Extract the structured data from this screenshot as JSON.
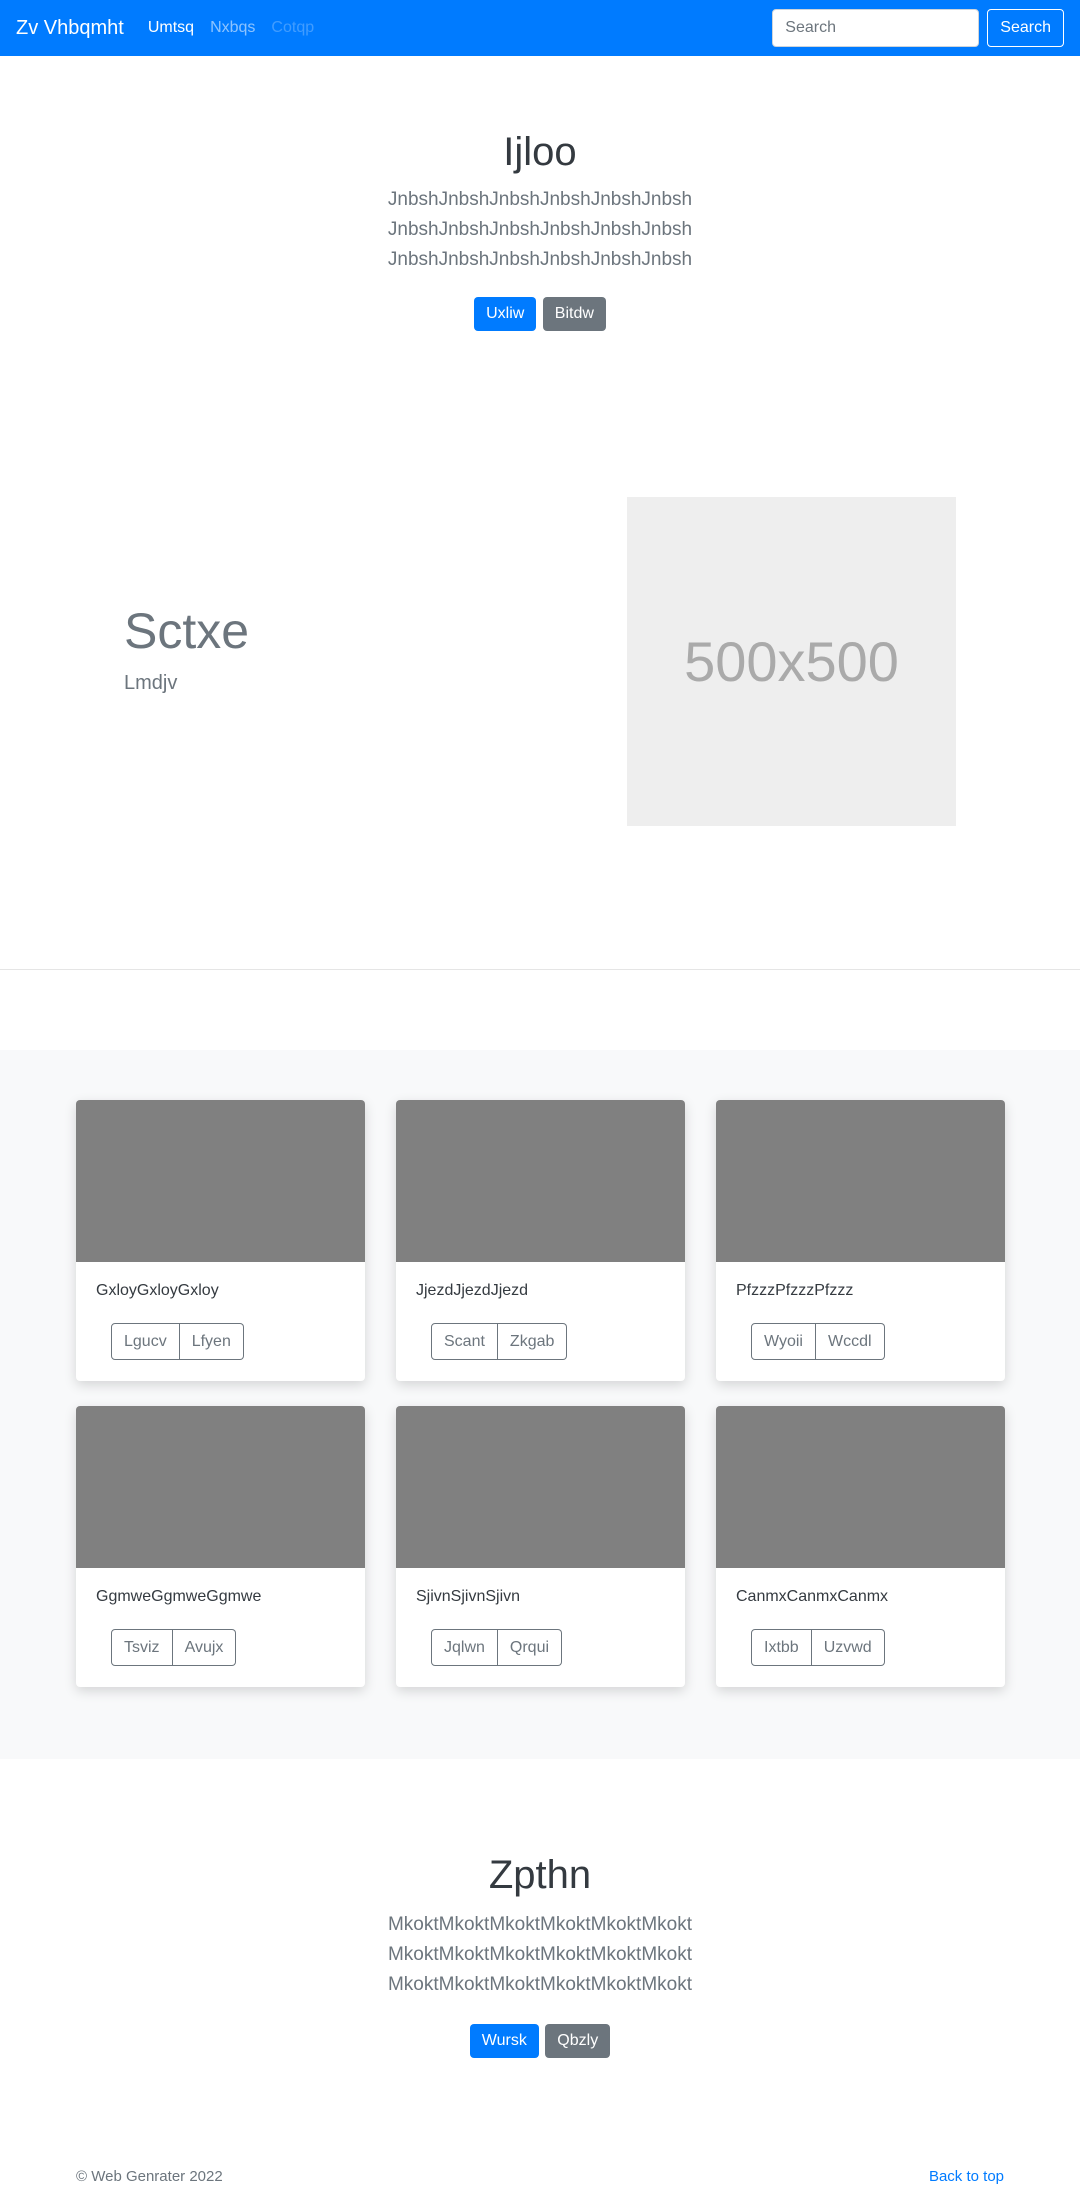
{
  "navbar": {
    "brand": "Zv Vhbqmht",
    "links": [
      {
        "label": "Umtsq"
      },
      {
        "label": "Nxbqs"
      },
      {
        "label": "Cotqp"
      }
    ],
    "search_placeholder": "Search",
    "search_button": "Search"
  },
  "hero": {
    "title": "Ijloo",
    "text": "JnbshJnbshJnbshJnbshJnbshJnbsh JnbshJnbshJnbshJnbshJnbshJnbsh JnbshJnbshJnbshJnbshJnbshJnbsh",
    "primary_button": "Uxliw",
    "secondary_button": "Bitdw"
  },
  "feature": {
    "title": "Sctxe",
    "subtitle": "Lmdjv",
    "placeholder_label": "500x500"
  },
  "cards": [
    {
      "text": "GxloyGxloyGxloy",
      "btn1": "Lgucv",
      "btn2": "Lfyen"
    },
    {
      "text": "JjezdJjezdJjezd",
      "btn1": "Scant",
      "btn2": "Zkgab"
    },
    {
      "text": "PfzzzPfzzzPfzzz",
      "btn1": "Wyoii",
      "btn2": "Wccdl"
    },
    {
      "text": "GgmweGgmweGgmwe",
      "btn1": "Tsviz",
      "btn2": "Avujx"
    },
    {
      "text": "SjivnSjivnSjivn",
      "btn1": "Jqlwn",
      "btn2": "Qrqui"
    },
    {
      "text": "CanmxCanmxCanmx",
      "btn1": "Ixtbb",
      "btn2": "Uzvwd"
    }
  ],
  "bottom_hero": {
    "title": "Zpthn",
    "text": "MkoktMkoktMkoktMkoktMkoktMkokt MkoktMkoktMkoktMkoktMkoktMkokt MkoktMkoktMkoktMkoktMkoktMkokt",
    "primary_button": "Wursk",
    "secondary_button": "Qbzly"
  },
  "footer": {
    "copyright": "© Web Genrater 2022",
    "back_to_top": "Back to top"
  }
}
